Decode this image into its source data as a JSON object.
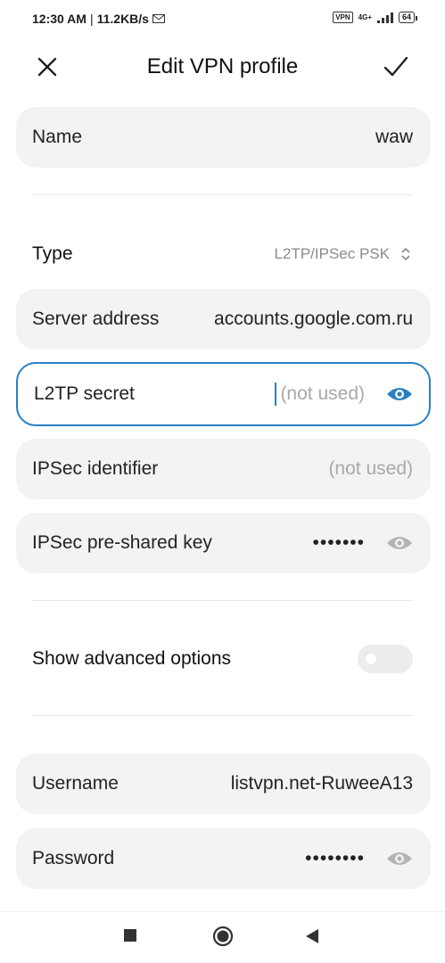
{
  "status_bar": {
    "time": "12:30 AM",
    "separator": "|",
    "speed": "11.2KB/s",
    "vpn": "VPN",
    "network": "4G+",
    "battery": "64",
    "icons": [
      "mail-icon",
      "vpn-icon",
      "signal-icon",
      "battery-icon"
    ]
  },
  "header": {
    "title": "Edit VPN profile",
    "close_icon": "close-icon",
    "save_icon": "checkmark-icon"
  },
  "form": {
    "name": {
      "label": "Name",
      "value": "waw"
    },
    "type": {
      "label": "Type",
      "value": "L2TP/IPSec PSK"
    },
    "server_address": {
      "label": "Server address",
      "value": "accounts.google.com.ru"
    },
    "l2tp_secret": {
      "label": "L2TP secret",
      "placeholder": "(not used)"
    },
    "ipsec_identifier": {
      "label": "IPSec identifier",
      "placeholder": "(not used)"
    },
    "ipsec_psk": {
      "label": "IPSec pre-shared key",
      "value": "•••••••"
    },
    "advanced": {
      "label": "Show advanced options",
      "enabled": false
    },
    "username": {
      "label": "Username",
      "value": "listvpn.net-RuweeA13"
    },
    "password": {
      "label": "Password",
      "value": "••••••••"
    }
  },
  "colors": {
    "accent": "#2a7fc1",
    "card_bg": "#f3f3f3",
    "placeholder": "#a8a8a8",
    "eye_inactive": "#b3b3b3"
  },
  "nav_bar": {
    "icons": [
      "recents-square-icon",
      "home-circle-icon",
      "back-triangle-icon"
    ]
  }
}
